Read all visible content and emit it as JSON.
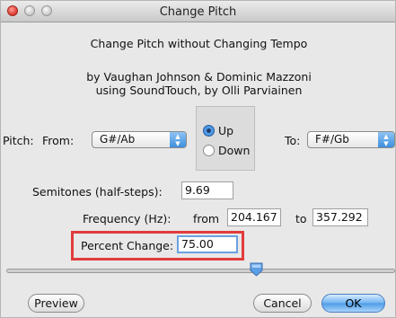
{
  "window": {
    "title": "Change Pitch"
  },
  "header": {
    "heading": "Change Pitch without Changing Tempo",
    "credit_line1": "by Vaughan Johnson & Dominic Mazzoni",
    "credit_line2": "using SoundTouch, by Olli Parviainen"
  },
  "pitch": {
    "label": "Pitch:",
    "from_label": "From:",
    "from_value": "G#/Ab",
    "direction_options": [
      "Up",
      "Down"
    ],
    "direction_selected": "Up",
    "to_label": "To:",
    "to_value": "F#/Gb"
  },
  "semitones": {
    "label": "Semitones (half-steps):",
    "value": "9.69"
  },
  "frequency": {
    "label": "Frequency (Hz):",
    "from_label": "from",
    "from_value": "204.167",
    "to_label": "to",
    "to_value": "357.292"
  },
  "percent": {
    "label": "Percent Change:",
    "value": "75.00"
  },
  "buttons": {
    "preview": "Preview",
    "cancel": "Cancel",
    "ok": "OK"
  },
  "colors": {
    "highlight": "#e13c3c",
    "accent": "#4d9be6",
    "focus": "#6ba1e0"
  }
}
